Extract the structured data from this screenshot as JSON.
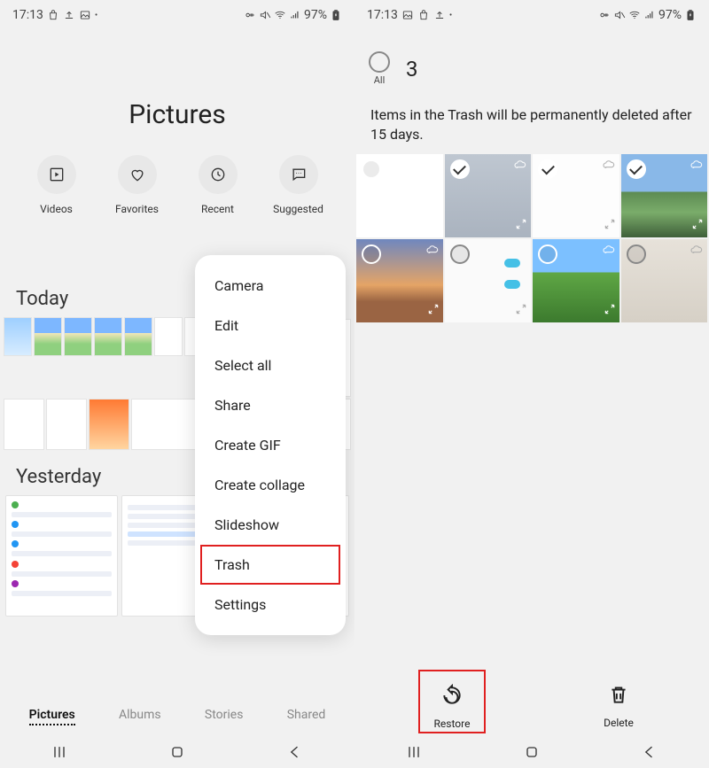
{
  "status": {
    "time": "17:13",
    "battery": "97%"
  },
  "left": {
    "title": "Pictures",
    "actions": {
      "videos": "Videos",
      "fav": "Favorites",
      "recent": "Recent",
      "sugg": "Suggested"
    },
    "sections": {
      "today": "Today",
      "yesterday": "Yesterday"
    },
    "tabs": {
      "pictures": "Pictures",
      "albums": "Albums",
      "stories": "Stories",
      "shared": "Shared"
    },
    "menu": {
      "camera": "Camera",
      "edit": "Edit",
      "selectall": "Select all",
      "share": "Share",
      "gif": "Create GIF",
      "collage": "Create collage",
      "slideshow": "Slideshow",
      "trash": "Trash",
      "settings": "Settings"
    }
  },
  "right": {
    "all_label": "All",
    "selected_count": "3",
    "warning": "Items in the Trash will be permanently deleted after 15 days.",
    "restore": "Restore",
    "delete": "Delete",
    "items": [
      {
        "selected": false
      },
      {
        "selected": true
      },
      {
        "selected": true
      },
      {
        "selected": true
      },
      {
        "selected": false
      },
      {
        "selected": false
      },
      {
        "selected": false
      },
      {
        "selected": false
      }
    ]
  }
}
